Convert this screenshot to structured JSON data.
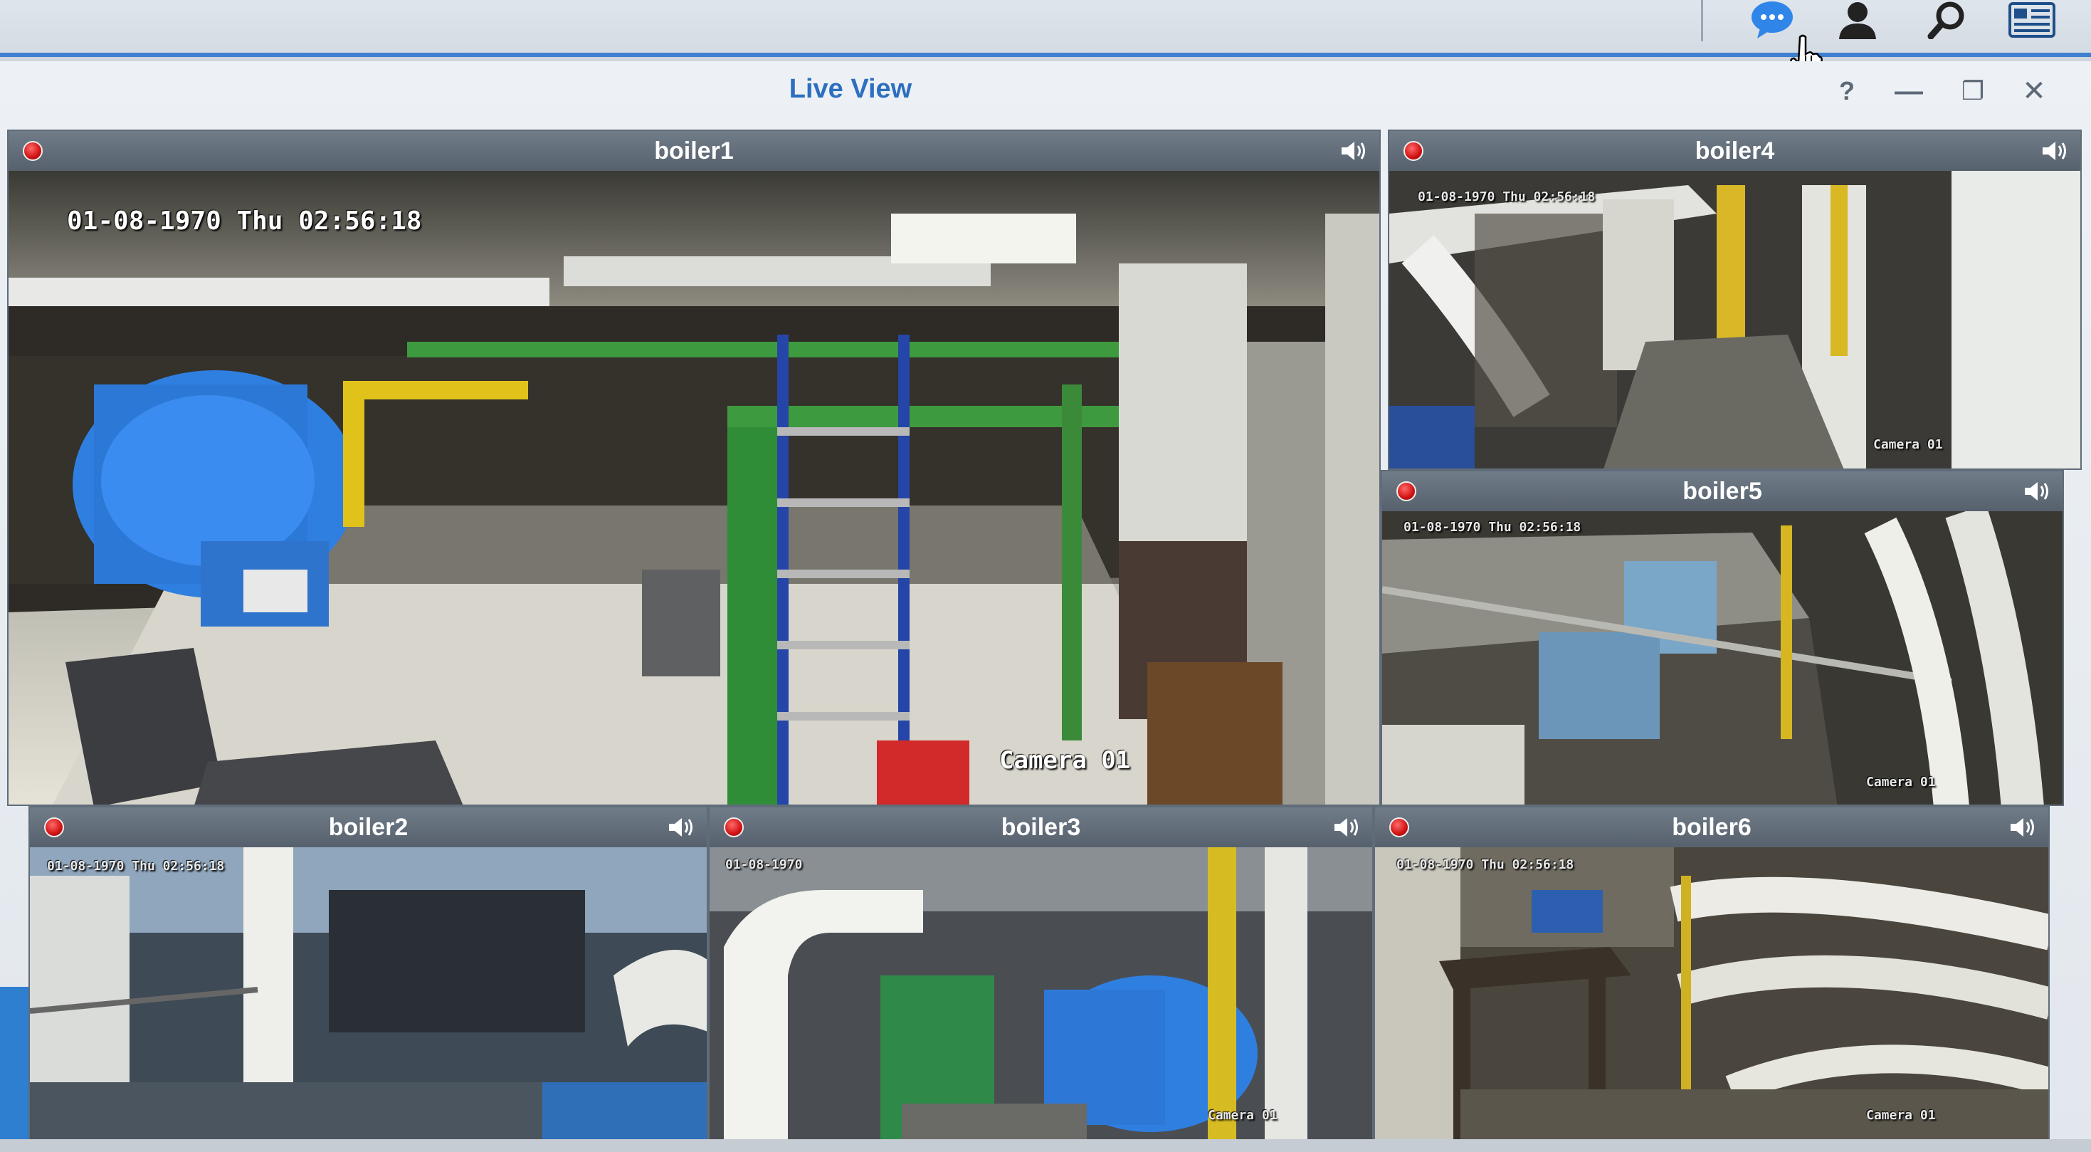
{
  "taskbar": {
    "icons": [
      "chat-icon",
      "user-icon",
      "search-icon",
      "widgets-icon"
    ]
  },
  "window": {
    "title": "Live View",
    "controls": {
      "help": "?",
      "minimize": "—",
      "restore": "❐",
      "close": "✕"
    }
  },
  "cameras": [
    {
      "name": "boiler1",
      "timestamp": "01-08-1970 Thu 02:56:18",
      "label": "Camera 01"
    },
    {
      "name": "boiler4",
      "timestamp": "01-08-1970 Thu 02:56:18",
      "label": "Camera 01"
    },
    {
      "name": "boiler5",
      "timestamp": "01-08-1970 Thu 02:56:18",
      "label": "Camera 01"
    },
    {
      "name": "boiler2",
      "timestamp": "01-08-1970 Thu 02:56:18",
      "label": ""
    },
    {
      "name": "boiler3",
      "timestamp": "01-08-1970",
      "label": "Camera 01"
    },
    {
      "name": "boiler6",
      "timestamp": "01-08-1970 Thu 02:56:18",
      "label": "Camera 01"
    }
  ],
  "colors": {
    "accent": "#3e7fd0",
    "title": "#2d6fbf",
    "record": "#d01212"
  }
}
